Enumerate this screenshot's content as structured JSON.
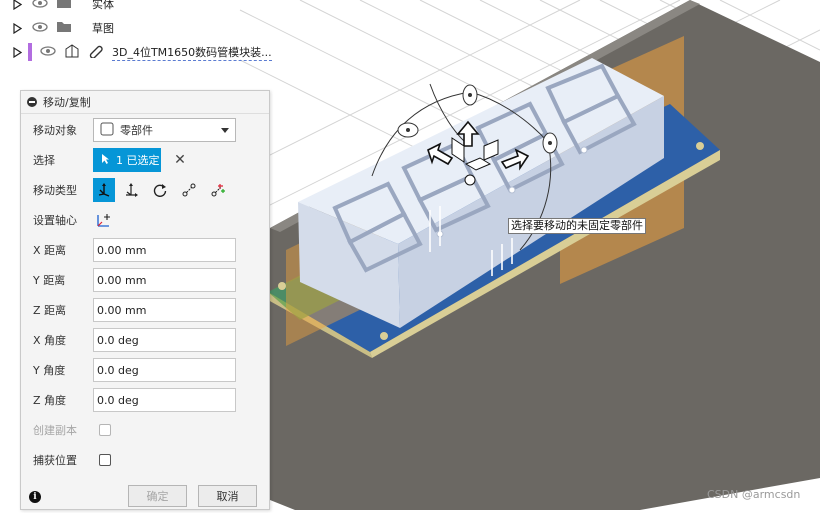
{
  "browser": {
    "rows": [
      {
        "label": "实体"
      },
      {
        "label": "草图"
      },
      {
        "label": "3D_4位TM1650数码管模块装..."
      }
    ]
  },
  "panel": {
    "title": "移动/复制",
    "move_object": {
      "label": "移动对象",
      "value": "零部件"
    },
    "selection": {
      "label": "选择",
      "value": "1 已选定",
      "clear": "✕"
    },
    "move_type": {
      "label": "移动类型"
    },
    "set_pivot": {
      "label": "设置轴心"
    },
    "fields": [
      {
        "label": "X 距离",
        "value": "0.00 mm"
      },
      {
        "label": "Y 距离",
        "value": "0.00 mm"
      },
      {
        "label": "Z 距离",
        "value": "0.00 mm"
      },
      {
        "label": "X 角度",
        "value": "0.0 deg"
      },
      {
        "label": "Y 角度",
        "value": "0.0 deg"
      },
      {
        "label": "Z 角度",
        "value": "0.0 deg"
      }
    ],
    "create_copy": {
      "label": "创建副本",
      "checked": false,
      "disabled": true
    },
    "capture_position": {
      "label": "捕获位置",
      "checked": false
    },
    "ok_label": "确定",
    "cancel_label": "取消",
    "info_glyph": "i"
  },
  "viewport": {
    "tooltip": "选择要移动的未固定零部件"
  },
  "watermark": "CSDN @armcsdn",
  "colors": {
    "accent": "#0696d7",
    "ground": "#6b6863",
    "display_body": "#dfe7f4",
    "pcb": "#2d60a8",
    "pcb_edge": "#d9ce96",
    "plane_orange": "#f0a13c"
  }
}
